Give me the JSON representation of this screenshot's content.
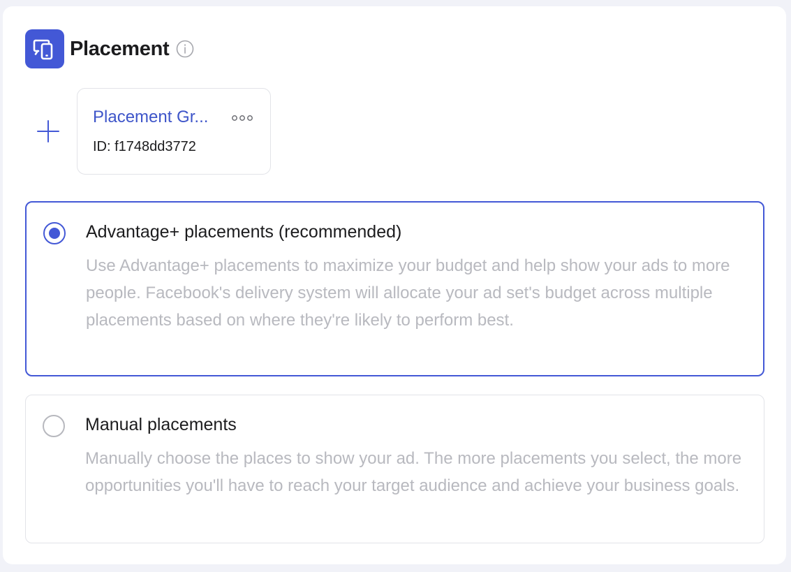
{
  "section": {
    "title": "Placement",
    "icon": "devices-icon",
    "info_icon": "info-icon"
  },
  "placement_group": {
    "name": "Placement Gr...",
    "id_label": "ID: f1748dd3772",
    "more_icon": "more-icon",
    "add_icon": "plus-icon"
  },
  "options": [
    {
      "title": "Advantage+ placements (recommended)",
      "description": "Use Advantage+ placements to maximize your budget and help show your ads to more people. Facebook's delivery system will allocate your ad set's budget across multiple placements based on where they're likely to perform best.",
      "selected": true
    },
    {
      "title": "Manual placements",
      "description": "Manually choose the places to show your ad. The more placements you select, the more opportunities you'll have to reach your target audience and achieve your business goals.",
      "selected": false
    }
  ],
  "colors": {
    "accent": "#4358d6",
    "link": "#3e55c9",
    "muted_text": "#b8b9bf",
    "border": "#e2e3e8"
  }
}
